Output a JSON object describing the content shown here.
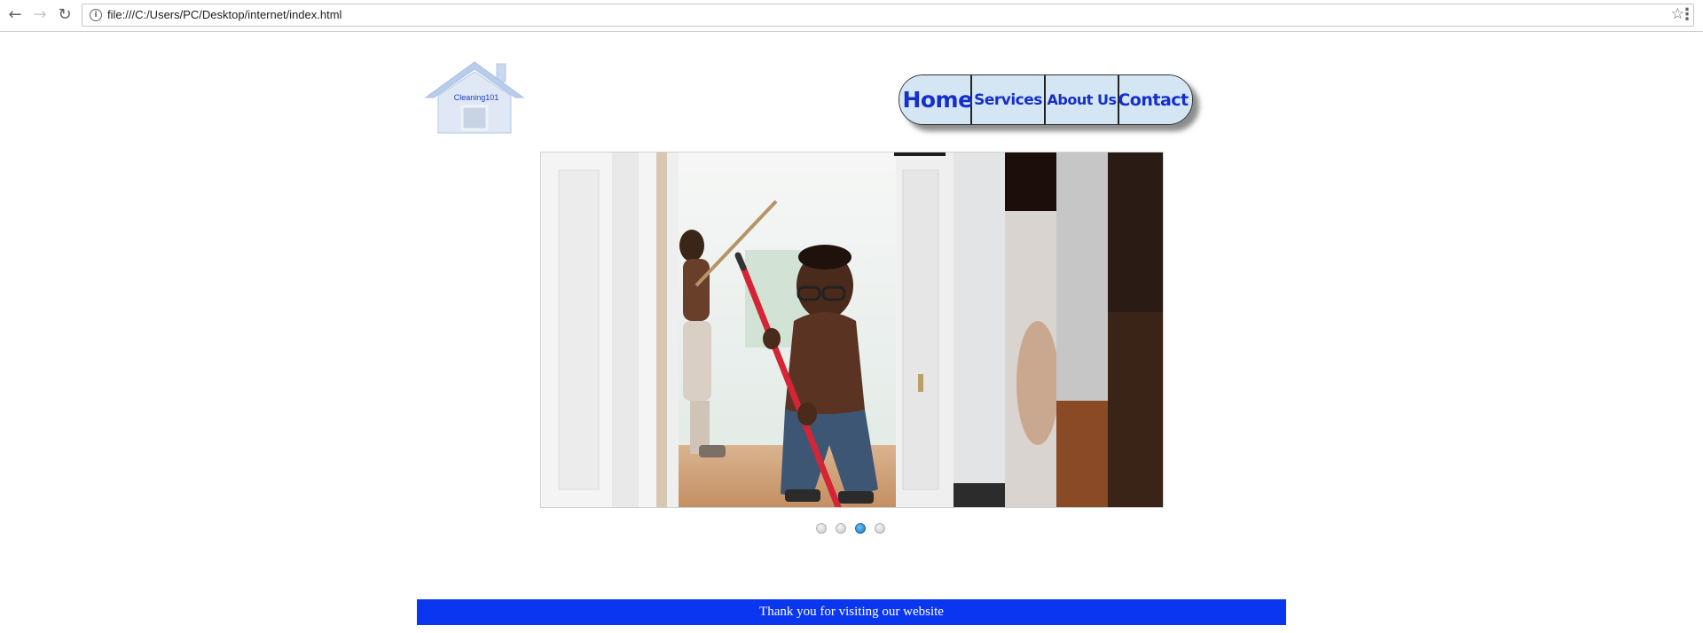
{
  "browser": {
    "back_icon": "arrow-left-icon",
    "forward_icon": "arrow-right-icon",
    "reload_icon": "reload-icon",
    "info_icon": "info-icon",
    "url": "file:///C:/Users/PC/Desktop/internet/index.html",
    "bookmark_icon": "star-icon",
    "menu_icon": "kebab-menu-icon"
  },
  "logo": {
    "text": "Cleaning101",
    "icon": "house-icon"
  },
  "nav": {
    "items": [
      {
        "label": "Home"
      },
      {
        "label": "Services"
      },
      {
        "label": "About Us"
      },
      {
        "label": "Contact"
      }
    ]
  },
  "slider": {
    "image_subject": "child-with-broom-photo",
    "dots": 4,
    "active_dot": 3
  },
  "footer": {
    "text": "Thank you for visiting our website"
  },
  "colors": {
    "nav_text": "#1530c8",
    "nav_bg": "#d4e6f3",
    "footer_bg": "#0a36ef",
    "active_dot": "#1677c4"
  }
}
